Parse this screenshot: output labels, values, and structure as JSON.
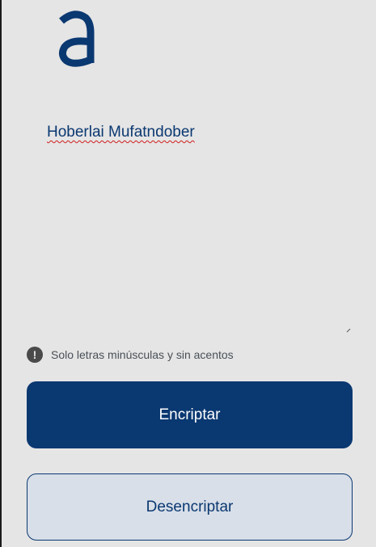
{
  "input": {
    "value": "Hoberlai Mufatndober"
  },
  "hint": {
    "icon": "exclamation-circle-icon",
    "text": "Solo letras minúsculas y sin acentos"
  },
  "buttons": {
    "encrypt_label": "Encriptar",
    "decrypt_label": "Desencriptar"
  },
  "colors": {
    "background": "#e5e5e5",
    "primary": "#0a3871",
    "secondary_bg": "#d8dfe8",
    "hint_icon": "#4a4a4a",
    "hint_text": "#495057"
  }
}
